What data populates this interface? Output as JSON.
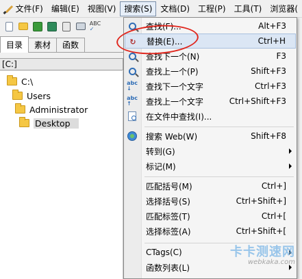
{
  "menubar": {
    "items": [
      {
        "label": "文件(F)"
      },
      {
        "label": "编辑(E)"
      },
      {
        "label": "视图(V)"
      },
      {
        "label": "搜索(S)",
        "active": true
      },
      {
        "label": "文档(D)"
      },
      {
        "label": "工程(P)"
      },
      {
        "label": "工具(T)"
      },
      {
        "label": "浏览器("
      }
    ]
  },
  "toolbar": {
    "icons": [
      "new-file-icon",
      "open-folder-icon",
      "save-icon",
      "save-all-icon",
      "cut-icon",
      "print-icon",
      "spellcheck-icon"
    ]
  },
  "sidebar": {
    "tabs": [
      {
        "label": "目录",
        "active": true
      },
      {
        "label": "素材"
      },
      {
        "label": "函数"
      }
    ],
    "path": "[C:]",
    "tree": [
      {
        "label": "C:\\",
        "depth": 0
      },
      {
        "label": "Users",
        "depth": 1
      },
      {
        "label": "Administrator",
        "depth": 2
      },
      {
        "label": "Desktop",
        "depth": 3,
        "selected": true
      }
    ]
  },
  "search_menu": {
    "items": [
      {
        "label": "查找(F)...",
        "shortcut": "Alt+F3",
        "icon": "find-icon"
      },
      {
        "label": "替换(E)...",
        "shortcut": "Ctrl+H",
        "icon": "replace-icon",
        "highlighted": true
      },
      {
        "label": "查找下一个(N)",
        "shortcut": "F3",
        "icon": "find-next-icon"
      },
      {
        "label": "查找上一个(P)",
        "shortcut": "Shift+F3",
        "icon": "find-previous-icon"
      },
      {
        "label": "查找下一个文字",
        "shortcut": "Ctrl+F3",
        "icon": "find-next-word-icon"
      },
      {
        "label": "查找上一个文字",
        "shortcut": "Ctrl+Shift+F3",
        "icon": "find-previous-word-icon"
      },
      {
        "label": "在文件中查找(I)...",
        "shortcut": "",
        "icon": "find-in-files-icon"
      },
      {
        "label": "搜索 Web(W)",
        "shortcut": "Shift+F8",
        "icon": "web-search-icon"
      },
      {
        "label": "转到(G)",
        "submenu": true
      },
      {
        "label": "标记(M)",
        "submenu": true
      },
      {
        "label": "匹配括号(M)",
        "shortcut": "Ctrl+]"
      },
      {
        "label": "选择括号(S)",
        "shortcut": "Ctrl+Shift+]"
      },
      {
        "label": "匹配标签(T)",
        "shortcut": "Ctrl+["
      },
      {
        "label": "选择标签(A)",
        "shortcut": "Ctrl+Shift+["
      },
      {
        "label": "CTags(C)",
        "submenu": true
      },
      {
        "label": "函数列表(L)",
        "submenu": true
      }
    ]
  },
  "watermark": {
    "text": "卡卡测速网",
    "url": "webkaka.com"
  },
  "colors": {
    "annotation": "#e0281f",
    "menu_highlight": "#dbe6f4"
  }
}
